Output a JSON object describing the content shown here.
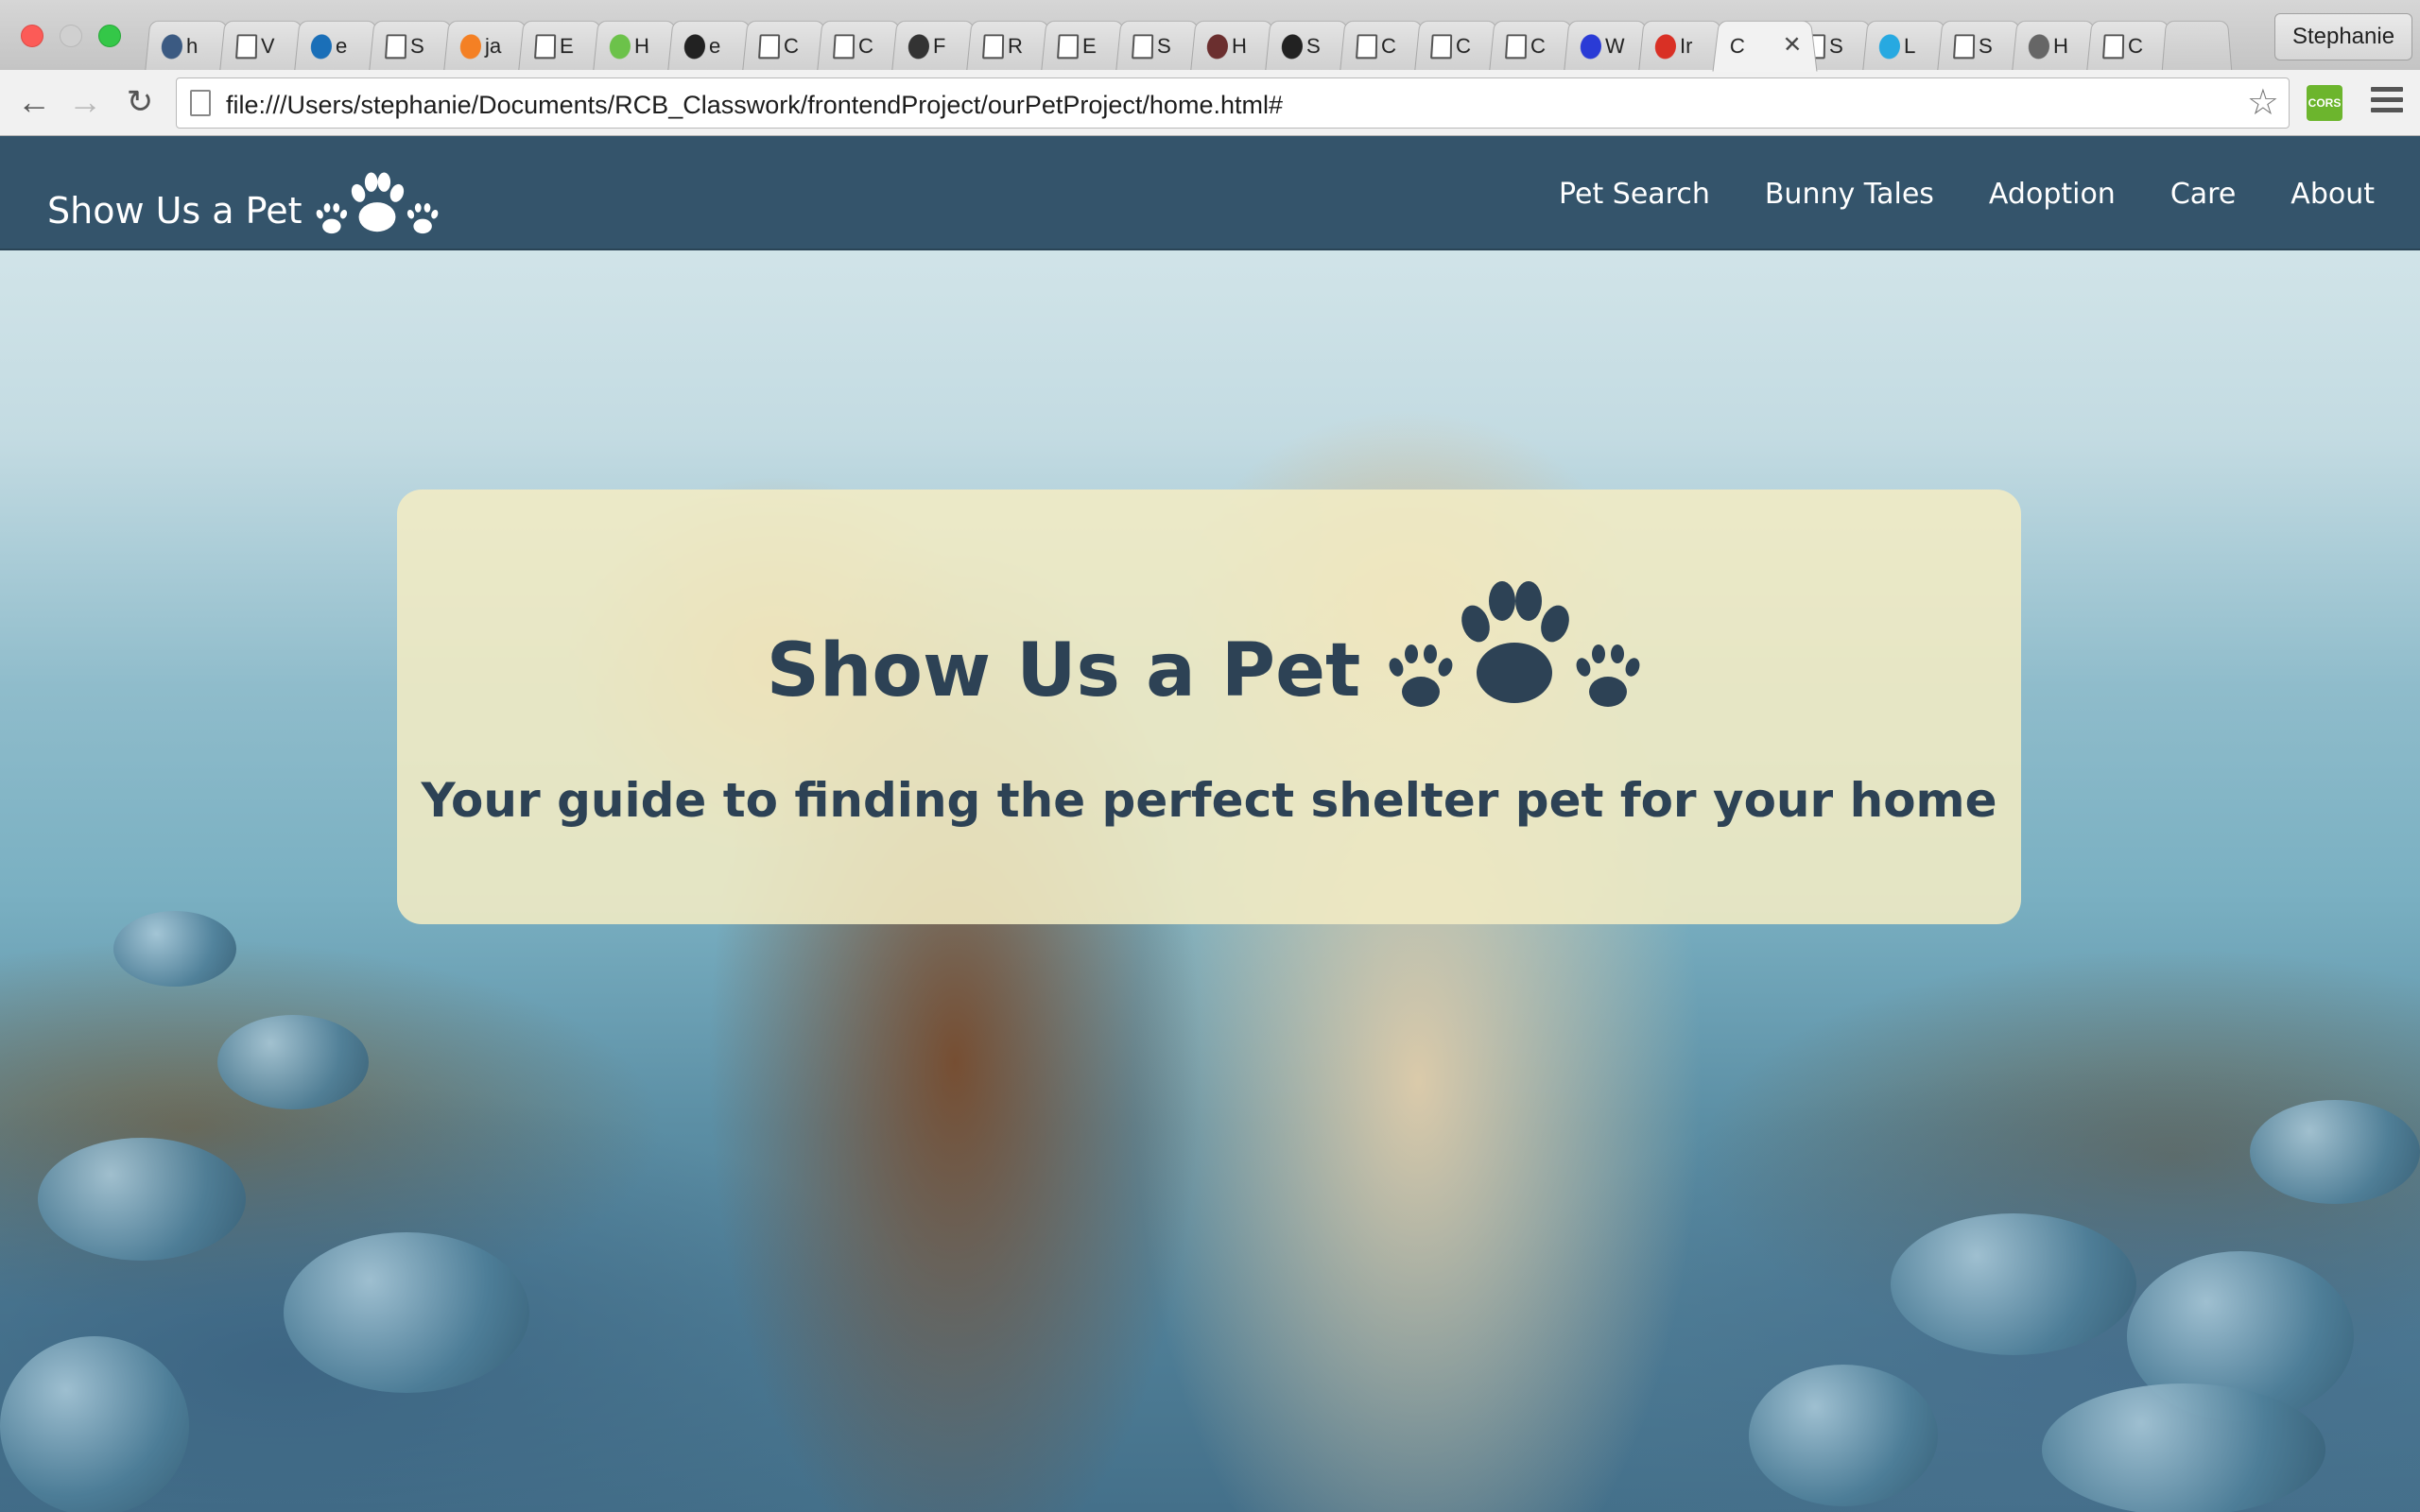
{
  "browser": {
    "tabs": [
      {
        "label": "h",
        "favicon": "ph-icon",
        "color": "#3b5a82"
      },
      {
        "label": "V",
        "favicon": "page-icon",
        "color": "#ffffff"
      },
      {
        "label": "e",
        "favicon": "e-icon",
        "color": "#1a6fb8"
      },
      {
        "label": "S",
        "favicon": "page-icon",
        "color": "#ffffff"
      },
      {
        "label": "ja",
        "favicon": "stack-icon",
        "color": "#f48024"
      },
      {
        "label": "E",
        "favicon": "page-icon",
        "color": "#ffffff"
      },
      {
        "label": "H",
        "favicon": "node-icon",
        "color": "#6cc24a"
      },
      {
        "label": "e",
        "favicon": "github-icon",
        "color": "#222222"
      },
      {
        "label": "C",
        "favicon": "page-icon",
        "color": "#ffffff"
      },
      {
        "label": "C",
        "favicon": "page-icon",
        "color": "#ffffff"
      },
      {
        "label": "F",
        "favicon": "camera-icon",
        "color": "#333333"
      },
      {
        "label": "R",
        "favicon": "page-icon",
        "color": "#ffffff"
      },
      {
        "label": "E",
        "favicon": "page-icon",
        "color": "#ffffff"
      },
      {
        "label": "S",
        "favicon": "page-icon",
        "color": "#ffffff"
      },
      {
        "label": "H",
        "favicon": "image-icon",
        "color": "#6b2f2f"
      },
      {
        "label": "S",
        "favicon": "github-icon",
        "color": "#222222"
      },
      {
        "label": "C",
        "favicon": "page-icon",
        "color": "#ffffff"
      },
      {
        "label": "C",
        "favicon": "page-icon",
        "color": "#ffffff"
      },
      {
        "label": "C",
        "favicon": "page-icon",
        "color": "#ffffff"
      },
      {
        "label": "W",
        "favicon": "d-icon",
        "color": "#2a3bd6"
      },
      {
        "label": "Ir",
        "favicon": "gmail-icon",
        "color": "#d93025"
      },
      {
        "label": "C",
        "favicon": "none",
        "color": "#f2f2f2",
        "active": true
      },
      {
        "label": "S",
        "favicon": "page-icon",
        "color": "#ffffff"
      },
      {
        "label": "L",
        "favicon": "ig-icon",
        "color": "#27a9e1"
      },
      {
        "label": "S",
        "favicon": "page-icon",
        "color": "#ffffff"
      },
      {
        "label": "H",
        "favicon": "apple-icon",
        "color": "#666666"
      },
      {
        "label": "C",
        "favicon": "page-icon",
        "color": "#ffffff"
      }
    ],
    "active_tab_close": "✕",
    "profile_name": "Stephanie",
    "url": "file:///Users/stephanie/Documents/RCB_Classwork/frontendProject/ourPetProject/home.html#",
    "extension_label": "CORS",
    "back_glyph": "←",
    "forward_glyph": "→",
    "reload_glyph": "↻",
    "star_glyph": "☆"
  },
  "site": {
    "brand": "Show Us a Pet",
    "nav": [
      "Pet Search",
      "Bunny Tales",
      "Adoption",
      "Care",
      "About"
    ],
    "hero_title": "Show Us a Pet",
    "hero_subtitle": "Your guide to finding the perfect shelter pet for your home",
    "colors": {
      "navbar": "#34546b",
      "card": "#f3ecc4",
      "heading": "#2d4255"
    }
  }
}
